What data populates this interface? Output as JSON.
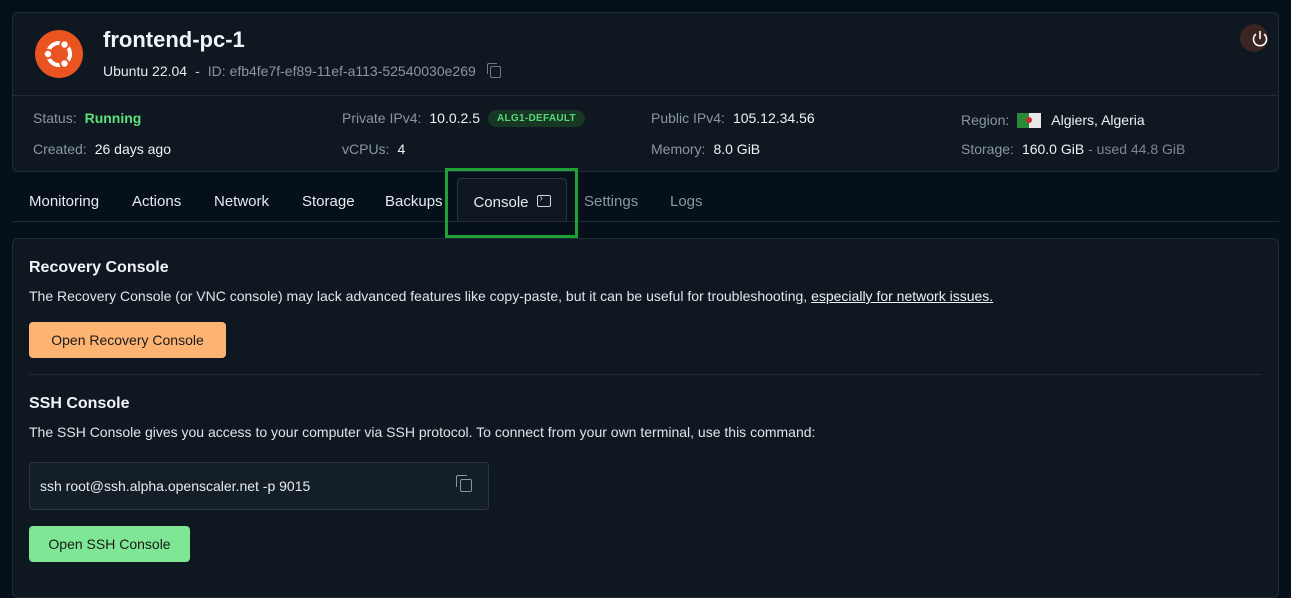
{
  "machine": {
    "name": "frontend-pc-1",
    "os": "Ubuntu 22.04",
    "separator": "-",
    "id_label": "ID:",
    "id_value": "efb4fe7f-ef89-11ef-a113-52540030e269"
  },
  "info": {
    "status_label": "Status:",
    "status_value": "Running",
    "created_label": "Created:",
    "created_value": "26 days ago",
    "private_ip_label": "Private IPv4:",
    "private_ip_value": "10.0.2.5",
    "private_ip_badge": "ALG1-DEFAULT",
    "vcpus_label": "vCPUs:",
    "vcpus_value": "4",
    "public_ip_label": "Public IPv4:",
    "public_ip_value": "105.12.34.56",
    "memory_label": "Memory:",
    "memory_value": "8.0 GiB",
    "region_label": "Region:",
    "region_value": "Algiers, Algeria",
    "storage_label": "Storage:",
    "storage_value": "160.0 GiB",
    "storage_used": "- used 44.8 GiB"
  },
  "tabs": [
    {
      "label": "Monitoring"
    },
    {
      "label": "Actions"
    },
    {
      "label": "Network"
    },
    {
      "label": "Storage"
    },
    {
      "label": "Backups"
    },
    {
      "label": "Console"
    },
    {
      "label": "Settings"
    },
    {
      "label": "Logs"
    }
  ],
  "recovery": {
    "title": "Recovery Console",
    "text": "The Recovery Console (or VNC console) may lack advanced features like copy-paste, but it can be useful for troubleshooting, ",
    "link": "especially for network issues.",
    "button": "Open Recovery Console"
  },
  "ssh": {
    "title": "SSH Console",
    "text": "The SSH Console gives you access to your computer via SSH protocol. To connect from your own terminal, use this command:",
    "command": "ssh root@ssh.alpha.openscaler.net -p 9015",
    "button": "Open SSH Console"
  },
  "colors": {
    "accent_green": "#5ee07a",
    "orange_button": "#fdb473",
    "green_button": "#7ee694",
    "ubuntu_orange": "#e95420",
    "highlight": "#1fa135"
  }
}
